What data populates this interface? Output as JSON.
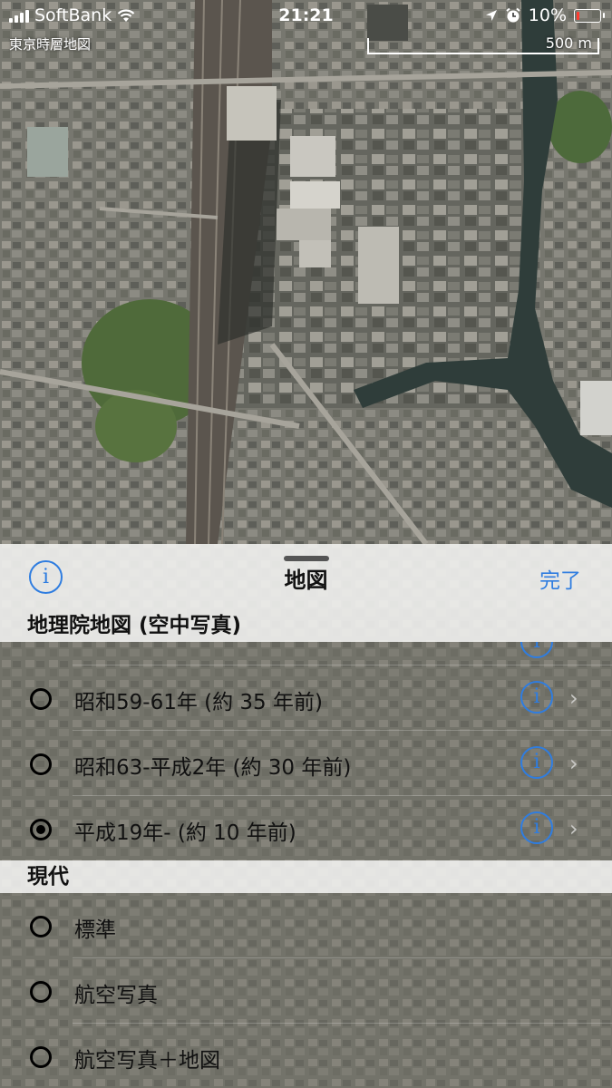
{
  "status_bar": {
    "carrier": "SoftBank",
    "time": "21:21",
    "battery": "10%"
  },
  "map": {
    "app_name": "東京時層地図",
    "scale_label": "500 m"
  },
  "sheet": {
    "title": "地図",
    "done_label": "完了",
    "info_glyph": "i",
    "sections": [
      {
        "header": "地理院地図 (空中写真)",
        "items": [
          {
            "label": "昭和59-61年 (約 35 年前)",
            "selected": false,
            "has_info": true
          },
          {
            "label": "昭和63-平成2年 (約 30 年前)",
            "selected": false,
            "has_info": true
          },
          {
            "label": "平成19年- (約 10 年前)",
            "selected": true,
            "has_info": true
          }
        ]
      },
      {
        "header": "現代",
        "items": [
          {
            "label": "標準",
            "selected": false,
            "has_info": false
          },
          {
            "label": "航空写真",
            "selected": false,
            "has_info": false
          },
          {
            "label": "航空写真＋地図",
            "selected": false,
            "has_info": false
          }
        ]
      }
    ],
    "chevron_glyph": "›"
  }
}
